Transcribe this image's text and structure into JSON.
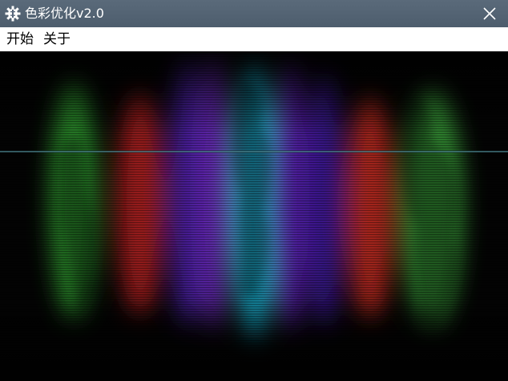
{
  "window": {
    "title": "色彩优化v2.0",
    "app_icon": "gear-icon",
    "close_icon": "close-icon"
  },
  "menu": {
    "items": [
      {
        "label": "开始"
      },
      {
        "label": "关于"
      }
    ]
  },
  "visual": {
    "bands": [
      {
        "color": "#2f9a2f"
      },
      {
        "color": "#b02020"
      },
      {
        "color": "#4a1fa8"
      },
      {
        "color": "#6a2ab8"
      },
      {
        "color": "#1ab6d8"
      },
      {
        "color": "#5a22b0"
      },
      {
        "color": "#3c1a9a"
      },
      {
        "color": "#c02a20"
      },
      {
        "color": "#3aa03a"
      }
    ],
    "scan_line_color": "#3f6f78"
  }
}
